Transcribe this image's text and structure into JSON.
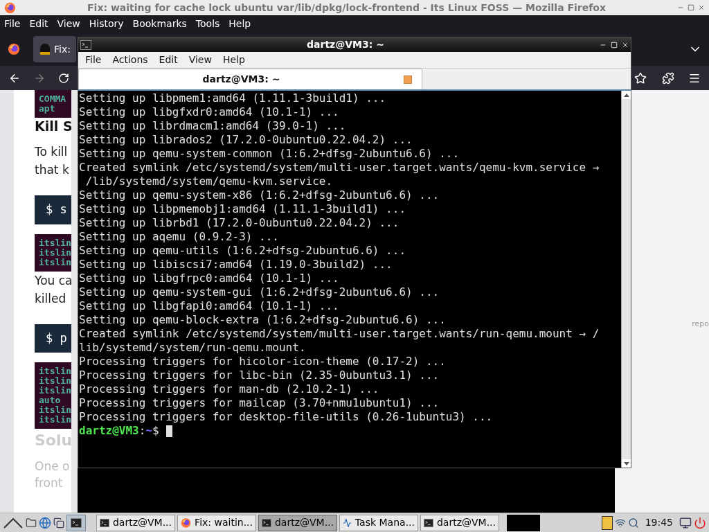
{
  "firefox": {
    "title": "Fix: waiting for cache lock ubuntu var/lib/dpkg/lock-frontend - Its Linux FOSS — Mozilla Firefox",
    "menu": [
      "File",
      "Edit",
      "View",
      "History",
      "Bookmarks",
      "Tools",
      "Help"
    ],
    "tab": {
      "title": "Fix:"
    },
    "page": [
      {
        "kind": "code",
        "color": "#300a24",
        "lines": [
          "COMMA",
          "apt"
        ]
      },
      {
        "kind": "heading",
        "lines": [
          "Kill S"
        ]
      },
      {
        "kind": "text",
        "lines": [
          "To kill",
          "that k"
        ]
      },
      {
        "kind": "command",
        "lines": [
          "$ s"
        ]
      },
      {
        "kind": "code",
        "color": "#300a24",
        "lines": [
          "itslin",
          "itslin",
          "itslin"
        ]
      },
      {
        "kind": "text",
        "lines": [
          "You ca",
          "killed"
        ]
      },
      {
        "kind": "command",
        "lines": [
          "$ p"
        ]
      },
      {
        "kind": "code",
        "color": "#300a24",
        "lines": [
          "itslin",
          "itslin",
          "itslin",
          "auto",
          "itslin",
          "itslin"
        ]
      },
      {
        "kind": "subheading",
        "lines": [
          "Solu"
        ]
      },
      {
        "kind": "faint",
        "lines": [
          "One o",
          "front"
        ]
      }
    ],
    "side_text": "repo"
  },
  "terminal": {
    "title": "dartz@VM3: ~",
    "menu": [
      "File",
      "Actions",
      "Edit",
      "View",
      "Help"
    ],
    "tab_title": "dartz@VM3: ~",
    "lines": [
      "Setting up libpmem1:amd64 (1.11.1-3build1) ...",
      "Setting up libgfxdr0:amd64 (10.1-1) ...",
      "Setting up librdmacm1:amd64 (39.0-1) ...",
      "Setting up librados2 (17.2.0-0ubuntu0.22.04.2) ...",
      "Setting up qemu-system-common (1:6.2+dfsg-2ubuntu6.6) ...",
      "Created symlink /etc/systemd/system/multi-user.target.wants/qemu-kvm.service →",
      " /lib/systemd/system/qemu-kvm.service.",
      "Setting up qemu-system-x86 (1:6.2+dfsg-2ubuntu6.6) ...",
      "Setting up libpmemobj1:amd64 (1.11.1-3build1) ...",
      "Setting up librbd1 (17.2.0-0ubuntu0.22.04.2) ...",
      "Setting up aqemu (0.9.2-3) ...",
      "Setting up qemu-utils (1:6.2+dfsg-2ubuntu6.6) ...",
      "Setting up libiscsi7:amd64 (1.19.0-3build2) ...",
      "Setting up libgfrpc0:amd64 (10.1-1) ...",
      "Setting up qemu-system-gui (1:6.2+dfsg-2ubuntu6.6) ...",
      "Setting up libgfapi0:amd64 (10.1-1) ...",
      "Setting up qemu-block-extra (1:6.2+dfsg-2ubuntu6.6) ...",
      "Created symlink /etc/systemd/system/multi-user.target.wants/run-qemu.mount → /",
      "lib/systemd/system/run-qemu.mount.",
      "Processing triggers for hicolor-icon-theme (0.17-2) ...",
      "Processing triggers for libc-bin (2.35-0ubuntu3.1) ...",
      "Processing triggers for man-db (2.10.2-1) ...",
      "Processing triggers for mailcap (3.70+nmu1ubuntu1) ...",
      "Processing triggers for desktop-file-utils (0.26-1ubuntu3) ..."
    ],
    "prompt": {
      "user": "dartz@VM3",
      "sep": ":",
      "path": "~",
      "sign": "$"
    }
  },
  "taskbar": {
    "tasks": [
      {
        "kind": "terminal",
        "label": "dartz@VM...",
        "selected": false
      },
      {
        "kind": "browser",
        "label": "Fix: waitin...",
        "selected": false
      },
      {
        "kind": "terminal",
        "label": "dartz@VM...",
        "selected": true
      },
      {
        "kind": "monitor",
        "label": "Task Mana...",
        "selected": false
      },
      {
        "kind": "terminal",
        "label": "dartz@VM...",
        "selected": false
      }
    ],
    "clock": "19:45"
  }
}
